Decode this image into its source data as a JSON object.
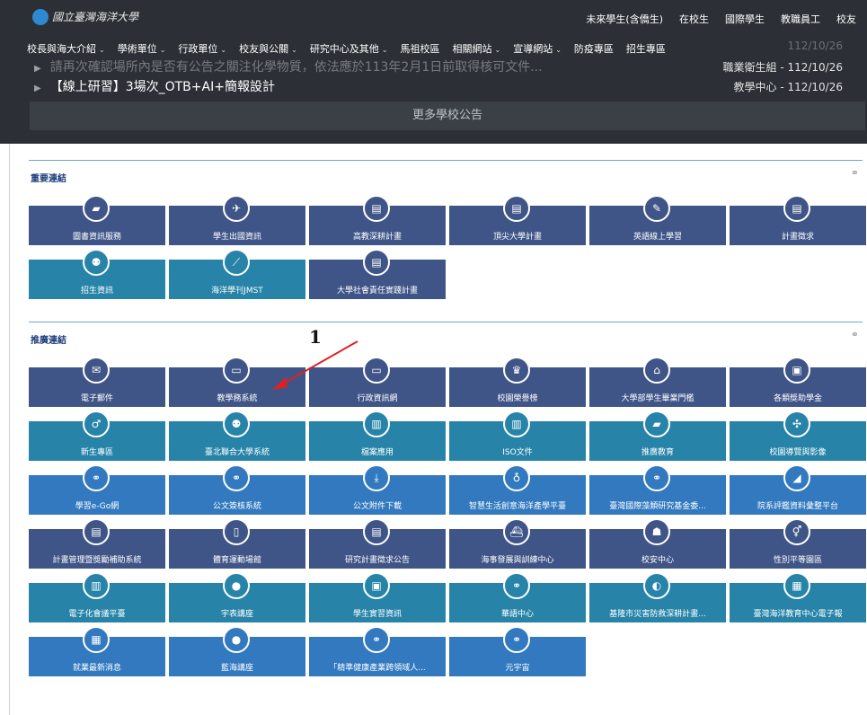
{
  "header": {
    "logo_text": "國立臺灣海洋大學",
    "top_links": [
      "未來學生(含僑生)",
      "在校生",
      "國際學生",
      "教職員工",
      "校友"
    ],
    "menu": [
      {
        "label": "校長與海大介紹",
        "caret": "⌄"
      },
      {
        "label": "學術單位",
        "caret": "⌄"
      },
      {
        "label": "行政單位",
        "caret": "⌄"
      },
      {
        "label": "校友與公關",
        "caret": "⌄"
      },
      {
        "label": "研究中心及其他",
        "caret": "⌄"
      },
      {
        "label": "馬祖校區",
        "caret": ""
      },
      {
        "label": "相關網站",
        "caret": "⌄"
      },
      {
        "label": "宣導網站",
        "caret": "⌄"
      },
      {
        "label": "防疫專區",
        "caret": ""
      },
      {
        "label": "招生專區",
        "caret": ""
      }
    ],
    "menu_right_date": "112/10/26"
  },
  "news": [
    {
      "title": "請再次確認場所內是否有公告之關注化學物質，依法應於113年2月1日前取得核可文件...",
      "date": "職業衛生組 - 112/10/26"
    },
    {
      "title": "【線上研習】3場次_OTB+AI+簡報設計",
      "date": "教學中心 - 112/10/26"
    }
  ],
  "more_button": "更多學校公告",
  "important": {
    "title": "重要連結",
    "link_icon": "⚭",
    "tiles": [
      {
        "label": "圖書資訊服務",
        "icon": "▰",
        "icon_name": "book-icon",
        "color": "navy"
      },
      {
        "label": "學生出國資訊",
        "icon": "✈",
        "icon_name": "airplane-icon",
        "color": "navy"
      },
      {
        "label": "高教深耕計畫",
        "icon": "▤",
        "icon_name": "list-icon",
        "color": "navy"
      },
      {
        "label": "頂尖大學計畫",
        "icon": "▤",
        "icon_name": "list-icon",
        "color": "navy"
      },
      {
        "label": "英語線上學習",
        "icon": "✎",
        "icon_name": "pencil-icon",
        "color": "navy"
      },
      {
        "label": "計畫徵求",
        "icon": "▤",
        "icon_name": "list-icon",
        "color": "navy"
      },
      {
        "label": "招生資訊",
        "icon": "⚉",
        "icon_name": "users-icon",
        "color": "teal"
      },
      {
        "label": "海洋學刊JMST",
        "icon": "⟋",
        "icon_name": "chart-line-icon",
        "color": "teal"
      },
      {
        "label": "大學社會責任實踐計畫",
        "icon": "▤",
        "icon_name": "list-icon",
        "color": "navy"
      }
    ]
  },
  "promo": {
    "title": "推廣連結",
    "link_icon": "⚭",
    "tiles": [
      {
        "label": "電子郵件",
        "icon": "✉",
        "icon_name": "mail-icon",
        "color": "navy"
      },
      {
        "label": "教學務系統",
        "icon": "▭",
        "icon_name": "laptop-icon",
        "color": "navy"
      },
      {
        "label": "行政資訊網",
        "icon": "▭",
        "icon_name": "laptop-icon",
        "color": "navy"
      },
      {
        "label": "校園榮譽榜",
        "icon": "♛",
        "icon_name": "trophy-icon",
        "color": "navy"
      },
      {
        "label": "大學部學生畢業門檻",
        "icon": "⌂",
        "icon_name": "graduation-cap-icon",
        "color": "navy"
      },
      {
        "label": "各類獎助學金",
        "icon": "▣",
        "icon_name": "money-icon",
        "color": "navy"
      },
      {
        "label": "新生專區",
        "icon": "♂",
        "icon_name": "person-icon",
        "color": "teal"
      },
      {
        "label": "臺北聯合大學系統",
        "icon": "⚉",
        "icon_name": "users-icon",
        "color": "teal"
      },
      {
        "label": "檔案應用",
        "icon": "▥",
        "icon_name": "document-icon",
        "color": "teal"
      },
      {
        "label": "ISO文件",
        "icon": "▥",
        "icon_name": "document-icon",
        "color": "teal"
      },
      {
        "label": "推廣教育",
        "icon": "▰",
        "icon_name": "book-icon",
        "color": "teal"
      },
      {
        "label": "校園導覽與影像",
        "icon": "✣",
        "icon_name": "compass-icon",
        "color": "teal"
      },
      {
        "label": "學習e-Go網",
        "icon": "⚭",
        "icon_name": "link-icon",
        "color": "blue"
      },
      {
        "label": "公文簽核系統",
        "icon": "⚭",
        "icon_name": "link-icon",
        "color": "blue"
      },
      {
        "label": "公文附件下載",
        "icon": "⤓",
        "icon_name": "download-icon",
        "color": "blue"
      },
      {
        "label": "智慧生活創意海洋產學平臺",
        "icon": "♁",
        "icon_name": "bulb-icon",
        "color": "blue"
      },
      {
        "label": "臺灣國際藻類研究基金委...",
        "icon": "⚭",
        "icon_name": "link-icon",
        "color": "blue"
      },
      {
        "label": "院系評鑑資料彙整平台",
        "icon": "◢",
        "icon_name": "area-chart-icon",
        "color": "blue"
      },
      {
        "label": "計畫管理暨獎勵補助系統",
        "icon": "▤",
        "icon_name": "list-icon",
        "color": "navy"
      },
      {
        "label": "體育運動場館",
        "icon": "▯",
        "icon_name": "building-icon",
        "color": "navy"
      },
      {
        "label": "研究計畫徵求公告",
        "icon": "▤",
        "icon_name": "list-icon",
        "color": "navy"
      },
      {
        "label": "海事發展與訓練中心",
        "icon": "⛴",
        "icon_name": "ship-icon",
        "color": "navy"
      },
      {
        "label": "校安中心",
        "icon": "☗",
        "icon_name": "guard-icon",
        "color": "navy"
      },
      {
        "label": "性別平等園區",
        "icon": "⚥",
        "icon_name": "gender-icon",
        "color": "navy"
      },
      {
        "label": "電子化會議平臺",
        "icon": "▥",
        "icon_name": "document-icon",
        "color": "teal"
      },
      {
        "label": "宇表講座",
        "icon": "●",
        "icon_name": "chat-bubble-icon",
        "color": "teal"
      },
      {
        "label": "學生實習資訊",
        "icon": "▣",
        "icon_name": "briefcase-icon",
        "color": "teal"
      },
      {
        "label": "華語中心",
        "icon": "⚭",
        "icon_name": "link-icon",
        "color": "teal"
      },
      {
        "label": "基隆市災害防救深耕計畫...",
        "icon": "◐",
        "icon_name": "shield-icon",
        "color": "teal"
      },
      {
        "label": "臺灣海洋教育中心電子報",
        "icon": "▦",
        "icon_name": "newspaper-icon",
        "color": "teal"
      },
      {
        "label": "就業最新消息",
        "icon": "▦",
        "icon_name": "newspaper-icon",
        "color": "blue"
      },
      {
        "label": "藍海講座",
        "icon": "●",
        "icon_name": "chat-bubble-icon",
        "color": "blue"
      },
      {
        "label": "「精準健康產業跨領域人...",
        "icon": "⚭",
        "icon_name": "link-icon",
        "color": "blue"
      },
      {
        "label": "元宇宙",
        "icon": "⚭",
        "icon_name": "link-icon",
        "color": "blue"
      }
    ]
  },
  "annotation": {
    "number": "1",
    "arrow_color": "#e02020"
  }
}
